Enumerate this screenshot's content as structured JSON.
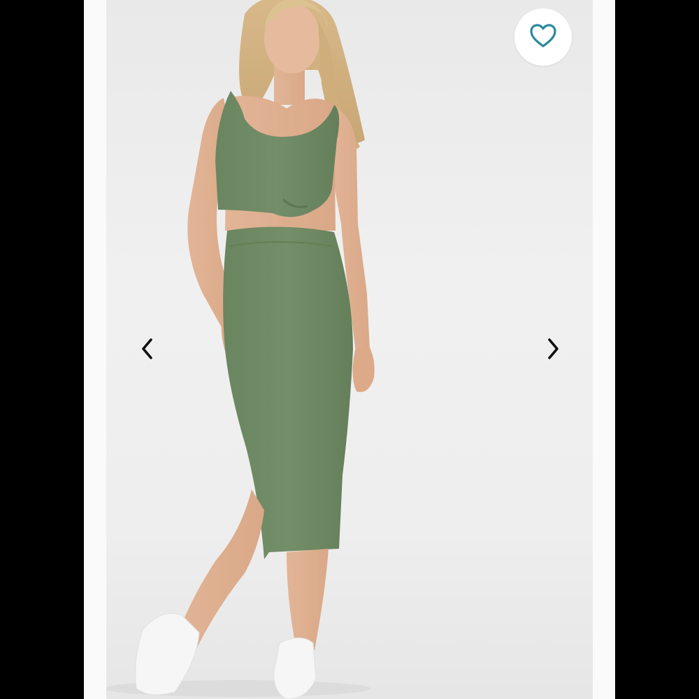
{
  "gallery": {
    "product_image_alt": "",
    "favorite_label": "",
    "prev_label": "",
    "next_label": ""
  },
  "colors": {
    "outfit": "#6f8a64",
    "background": "#eeeeee",
    "heart": "#2b8a9e",
    "side_bars": "#000000"
  },
  "icons": {
    "favorite": "heart-outline-icon",
    "prev": "chevron-left-icon",
    "next": "chevron-right-icon"
  }
}
